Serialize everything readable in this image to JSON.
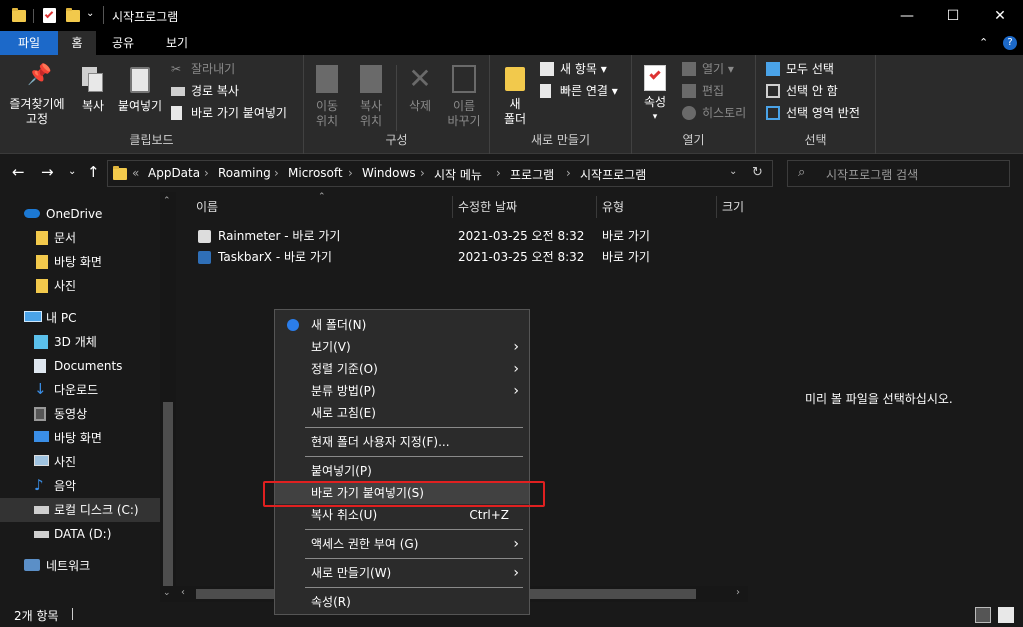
{
  "window": {
    "title": "시작프로그램"
  },
  "menubar": {
    "tabs": [
      "파일",
      "홈",
      "공유",
      "보기"
    ]
  },
  "ribbon": {
    "clipboard": {
      "pin": "즐겨찾기에\n고정",
      "copy": "복사",
      "paste": "붙여넣기",
      "cut": "잘라내기",
      "copy_path": "경로 복사",
      "paste_shortcut": "바로 가기 붙여넣기",
      "group": "클립보드"
    },
    "organize": {
      "move": "이동\n위치",
      "copy_to": "복사\n위치",
      "delete": "삭제",
      "rename": "이름\n바꾸기",
      "group": "구성"
    },
    "new": {
      "new_folder": "새\n폴더",
      "new_item": "새 항목",
      "easy_access": "빠른 연결",
      "group": "새로 만들기"
    },
    "open": {
      "properties": "속성",
      "open": "열기",
      "edit": "편집",
      "history": "히스토리",
      "group": "열기"
    },
    "select": {
      "select_all": "모두 선택",
      "select_none": "선택 안 함",
      "invert": "선택 영역 반전",
      "group": "선택"
    }
  },
  "address": {
    "prefix": "«",
    "crumbs": [
      "AppData",
      "Roaming",
      "Microsoft",
      "Windows",
      "시작 메뉴",
      "프로그램",
      "시작프로그램"
    ],
    "search_placeholder": "시작프로그램 검색"
  },
  "nav": [
    {
      "label": "OneDrive",
      "icon": "cloud-icon",
      "indent": 1
    },
    {
      "label": "문서",
      "icon": "folder-icon",
      "indent": 2
    },
    {
      "label": "바탕 화면",
      "icon": "folder-icon",
      "indent": 2
    },
    {
      "label": "사진",
      "icon": "folder-icon",
      "indent": 2
    },
    {
      "label": "내 PC",
      "icon": "pc-icon",
      "indent": 1
    },
    {
      "label": "3D 개체",
      "icon": "cube-icon",
      "indent": 2
    },
    {
      "label": "Documents",
      "icon": "documents-icon",
      "indent": 2
    },
    {
      "label": "다운로드",
      "icon": "download-icon",
      "indent": 2
    },
    {
      "label": "동영상",
      "icon": "video-icon",
      "indent": 2
    },
    {
      "label": "바탕 화면",
      "icon": "desktop-icon",
      "indent": 2
    },
    {
      "label": "사진",
      "icon": "pictures-icon",
      "indent": 2
    },
    {
      "label": "음악",
      "icon": "music-icon",
      "indent": 2
    },
    {
      "label": "로컬 디스크 (C:)",
      "icon": "drive-icon",
      "indent": 2
    },
    {
      "label": "DATA (D:)",
      "icon": "drive-icon",
      "indent": 2
    },
    {
      "label": "네트워크",
      "icon": "network-icon",
      "indent": 1
    }
  ],
  "columns": [
    "이름",
    "수정한 날짜",
    "유형",
    "크기"
  ],
  "files": [
    {
      "name": "Rainmeter - 바로 가기",
      "date": "2021-03-25 오전 8:32",
      "type": "바로 가기"
    },
    {
      "name": "TaskbarX - 바로 가기",
      "date": "2021-03-25 오전 8:32",
      "type": "바로 가기"
    }
  ],
  "preview_text": "미리 볼 파일을 선택하십시오.",
  "status": {
    "count": "2개 항목"
  },
  "context_menu": {
    "items": [
      {
        "label": "새 폴더(N)",
        "submenu": false
      },
      {
        "label": "보기(V)",
        "submenu": true
      },
      {
        "label": "정렬 기준(O)",
        "submenu": true
      },
      {
        "label": "분류 방법(P)",
        "submenu": true
      },
      {
        "label": "새로 고침(E)",
        "submenu": false
      },
      {
        "label": "현재 폴더 사용자 지정(F)...",
        "submenu": false
      },
      {
        "label": "붙여넣기(P)",
        "submenu": false
      },
      {
        "label": "바로 가기 붙여넣기(S)",
        "submenu": false
      },
      {
        "label": "복사 취소(U)",
        "submenu": false,
        "shortcut": "Ctrl+Z"
      },
      {
        "label": "액세스 권한 부여 (G)",
        "submenu": true
      },
      {
        "label": "새로 만들기(W)",
        "submenu": true
      },
      {
        "label": "속성(R)",
        "submenu": false
      }
    ]
  },
  "colors": {
    "accent": "#1c69c9",
    "highlight_box": "#e02020"
  }
}
